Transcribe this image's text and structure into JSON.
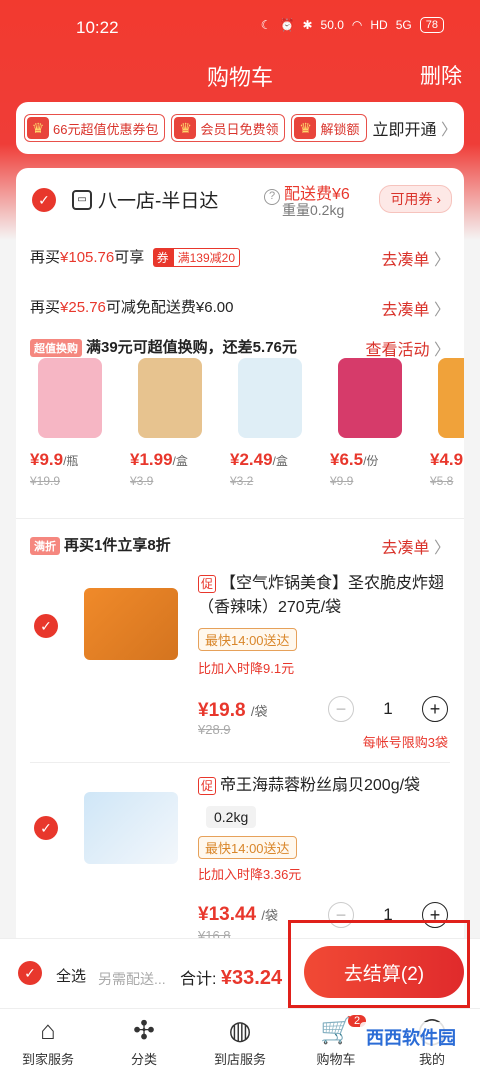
{
  "status": {
    "time": "10:22",
    "net": "50.0",
    "hd": "HD",
    "sig": "5G",
    "battery": "78"
  },
  "header": {
    "title": "购物车",
    "delete_label": "删除"
  },
  "promo": {
    "chips": [
      "66元超值优惠券包",
      "会员日免费领",
      "解锁额"
    ],
    "open_label": "立即开通"
  },
  "store": {
    "name": "八一店-半日达",
    "fee_label": "配送费¥6",
    "weight": "重量0.2kg",
    "coupon_btn": "可用券"
  },
  "offers": [
    {
      "pre": "再买",
      "amount": "¥105.76",
      "post": "可享",
      "tag": "券",
      "tag_text": "满139减20",
      "link": "去凑单"
    },
    {
      "pre": "再买",
      "amount": "¥25.76",
      "post": "可减免配送费¥6.00",
      "link": "去凑单"
    }
  ],
  "swap": {
    "tag": "超值换购",
    "text": "满39元可超值换购，还差5.76元",
    "link": "查看活动"
  },
  "swap_products": [
    {
      "price": "¥9.9",
      "unit": "/瓶",
      "orig": "¥19.9",
      "color": "#f6b6c4"
    },
    {
      "price": "¥1.99",
      "unit": "/盒",
      "orig": "¥3.9",
      "color": "#e7c38f"
    },
    {
      "price": "¥2.49",
      "unit": "/盒",
      "orig": "¥3.2",
      "color": "#dfeef6"
    },
    {
      "price": "¥6.5",
      "unit": "/份",
      "orig": "¥9.9",
      "color": "#d63b6a"
    },
    {
      "price": "¥4.9",
      "unit": "",
      "orig": "¥5.8",
      "color": "#f0a23a"
    }
  ],
  "discount": {
    "tag": "满折",
    "text": "再买1件立享8折",
    "link": "去凑单"
  },
  "items": [
    {
      "name": "【空气炸锅美食】圣农脆皮炸翅（香辣味）270克/袋",
      "cu": "促",
      "fast": "最快14:00送达",
      "drop": "比加入时降9.1元",
      "price": "¥19.8",
      "unit": "/袋",
      "orig": "¥28.9",
      "qty": "1",
      "limit": "每帐号限购3袋"
    },
    {
      "name": "帝王海蒜蓉粉丝扇贝200g/袋",
      "cu": "促",
      "weight": "0.2kg",
      "fast": "最快14:00送达",
      "drop": "比加入时降3.36元",
      "price": "¥13.44",
      "unit": "/袋",
      "orig": "¥16.8",
      "qty": "1"
    }
  ],
  "bottom": {
    "select_all": "全选",
    "note": "另需配送...",
    "total_label": "合计:",
    "total": "¥33.24",
    "checkout": "去结算(2)"
  },
  "nav": [
    {
      "label": "到家服务"
    },
    {
      "label": "分类"
    },
    {
      "label": "到店服务"
    },
    {
      "label": "购物车",
      "badge": "2"
    },
    {
      "label": "我的"
    }
  ],
  "watermark": "西西软件园"
}
